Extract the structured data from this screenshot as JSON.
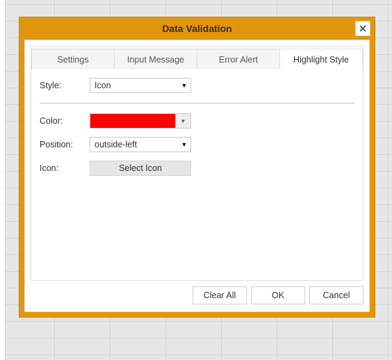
{
  "dialog": {
    "title": "Data Validation"
  },
  "tabs": {
    "t0": "Settings",
    "t1": "Input Message",
    "t2": "Error Alert",
    "t3": "Highlight Style"
  },
  "form": {
    "style_label": "Style:",
    "style_value": "Icon",
    "color_label": "Color:",
    "color_value": "#ff0000",
    "position_label": "Position:",
    "position_value": "outside-left",
    "icon_label": "Icon:",
    "select_icon_label": "Select Icon"
  },
  "buttons": {
    "clear_all": "Clear All",
    "ok": "OK",
    "cancel": "Cancel"
  }
}
